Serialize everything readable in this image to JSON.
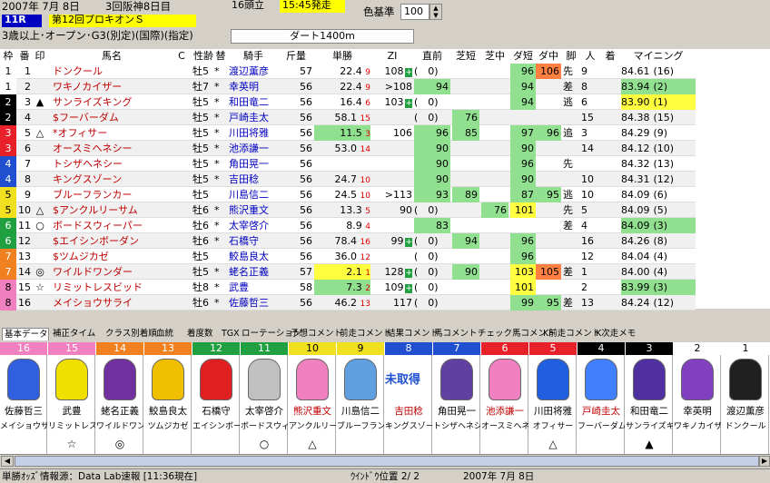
{
  "header": {
    "date": "2007年 7月 8日",
    "meeting": "3回阪神8日目",
    "field_size": "16頭立",
    "post_time": "15:45発走",
    "race_no": "11R",
    "race_name": "第12回プロキオンＳ",
    "conditions": "3歳以上･オープン･G3(別定)(国際)(指定)",
    "course": "ダート1400m",
    "color_label": "色基準",
    "color_value": "100"
  },
  "columns": [
    "枠",
    "番",
    "印",
    "馬名",
    "C",
    "性齢",
    "替",
    "騎手",
    "斤量",
    "単勝",
    "ZI",
    "直前",
    "芝短",
    "芝中",
    "ダ短",
    "ダ中",
    "脚",
    "人",
    "着",
    "マイニング"
  ],
  "rows": [
    {
      "waku": "1",
      "ban": "1",
      "mark": "",
      "name": "ドンクール",
      "sexage": "牡5",
      "ch": "*",
      "jockey": "渡辺薫彦",
      "kin": "57",
      "odds": "22.4",
      "pop": "9",
      "zi": "108",
      "zi_mark": "+",
      "choku": "(　0)",
      "shiba_s": "",
      "shiba_m": "",
      "da_s": "96",
      "da_m": "106",
      "kyaku": "先",
      "ninki": "9",
      "chaku": "",
      "mining": "84.61",
      "mrank": "(16)"
    },
    {
      "waku": "1",
      "ban": "2",
      "mark": "",
      "name": "ワキノカイザー",
      "sexage": "牡7",
      "ch": "*",
      "jockey": "幸英明",
      "kin": "56",
      "odds": "22.4",
      "pop": "9",
      "zi": ">108",
      "zi_mark": "",
      "choku": "94",
      "shiba_s": "",
      "shiba_m": "",
      "da_s": "94",
      "da_m": "",
      "kyaku": "差",
      "ninki": "8",
      "chaku": "",
      "mining": "83.94",
      "mrank": "(2)"
    },
    {
      "waku": "2",
      "ban": "3",
      "mark": "▲",
      "name": "サンライズキング",
      "sexage": "牡5",
      "ch": "*",
      "jockey": "和田竜二",
      "kin": "56",
      "odds": "16.4",
      "pop": "6",
      "zi": "103",
      "zi_mark": "+",
      "choku": "(　0)",
      "shiba_s": "",
      "shiba_m": "",
      "da_s": "94",
      "da_m": "",
      "kyaku": "逃",
      "ninki": "6",
      "chaku": "",
      "mining": "83.90",
      "mrank": "(1)"
    },
    {
      "waku": "2",
      "ban": "4",
      "mark": "",
      "name": "$フーバーダム",
      "sexage": "牡5",
      "ch": "*",
      "jockey": "戸崎圭太",
      "kin": "56",
      "odds": "58.1",
      "pop": "15",
      "zi": "",
      "zi_mark": "",
      "choku": "(　0)",
      "shiba_s": "76",
      "shiba_m": "",
      "da_s": "",
      "da_m": "",
      "kyaku": "",
      "ninki": "15",
      "chaku": "",
      "mining": "84.38",
      "mrank": "(15)"
    },
    {
      "waku": "3",
      "ban": "5",
      "mark": "△",
      "name": "*オフィサー",
      "sexage": "牡5",
      "ch": "*",
      "jockey": "川田将雅",
      "kin": "56",
      "odds": "11.5",
      "pop": "3",
      "zi": "106",
      "zi_mark": "",
      "choku": "96",
      "shiba_s": "85",
      "shiba_m": "",
      "da_s": "97",
      "da_m": "96",
      "kyaku": "追",
      "ninki": "3",
      "chaku": "",
      "mining": "84.29",
      "mrank": "(9)"
    },
    {
      "waku": "3",
      "ban": "6",
      "mark": "",
      "name": "オースミヘネシー",
      "sexage": "牡5",
      "ch": "*",
      "jockey": "池添謙一",
      "kin": "56",
      "odds": "53.0",
      "pop": "14",
      "zi": "",
      "zi_mark": "",
      "choku": "90",
      "shiba_s": "",
      "shiba_m": "",
      "da_s": "90",
      "da_m": "",
      "kyaku": "",
      "ninki": "14",
      "chaku": "",
      "mining": "84.12",
      "mrank": "(10)"
    },
    {
      "waku": "4",
      "ban": "7",
      "mark": "",
      "name": "トシザヘネシー",
      "sexage": "牡5",
      "ch": "*",
      "jockey": "角田晃一",
      "kin": "56",
      "odds": "",
      "pop": "",
      "zi": "",
      "zi_mark": "",
      "choku": "90",
      "shiba_s": "",
      "shiba_m": "",
      "da_s": "96",
      "da_m": "",
      "kyaku": "先",
      "ninki": "",
      "chaku": "",
      "mining": "84.32",
      "mrank": "(13)"
    },
    {
      "waku": "4",
      "ban": "8",
      "mark": "",
      "name": "キングスゾーン",
      "sexage": "牡5",
      "ch": "*",
      "jockey": "吉田稔",
      "kin": "56",
      "odds": "24.7",
      "pop": "10",
      "zi": "",
      "zi_mark": "",
      "choku": "90",
      "shiba_s": "",
      "shiba_m": "",
      "da_s": "90",
      "da_m": "",
      "kyaku": "",
      "ninki": "10",
      "chaku": "",
      "mining": "84.31",
      "mrank": "(12)"
    },
    {
      "waku": "5",
      "ban": "9",
      "mark": "",
      "name": "ブルーフランカー",
      "sexage": "牡5",
      "ch": "",
      "jockey": "川島信二",
      "kin": "56",
      "odds": "24.5",
      "pop": "10",
      "zi": ">113",
      "zi_mark": "",
      "choku": "93",
      "shiba_s": "89",
      "shiba_m": "",
      "da_s": "87",
      "da_m": "95",
      "kyaku": "逃",
      "ninki": "10",
      "chaku": "",
      "mining": "84.09",
      "mrank": "(6)"
    },
    {
      "waku": "5",
      "ban": "10",
      "mark": "△",
      "name": "$アンクルリーサム",
      "sexage": "牡6",
      "ch": "*",
      "jockey": "熊沢重文",
      "kin": "56",
      "odds": "13.3",
      "pop": "5",
      "zi": "90",
      "zi_mark": "",
      "choku": "(　0)",
      "shiba_s": "",
      "shiba_m": "76",
      "da_s": "101",
      "da_m": "",
      "kyaku": "先",
      "ninki": "5",
      "chaku": "",
      "mining": "84.09",
      "mrank": "(5)"
    },
    {
      "waku": "6",
      "ban": "11",
      "mark": "○",
      "name": "ボードスウィーパー",
      "sexage": "牡6",
      "ch": "*",
      "jockey": "太宰啓介",
      "kin": "56",
      "odds": "8.9",
      "pop": "4",
      "zi": "",
      "zi_mark": "",
      "choku": "83",
      "shiba_s": "",
      "shiba_m": "",
      "da_s": "",
      "da_m": "",
      "kyaku": "差",
      "ninki": "4",
      "chaku": "",
      "mining": "84.09",
      "mrank": "(3)"
    },
    {
      "waku": "6",
      "ban": "12",
      "mark": "",
      "name": "$エイシンボーダン",
      "sexage": "牡6",
      "ch": "*",
      "jockey": "石橋守",
      "kin": "56",
      "odds": "78.4",
      "pop": "16",
      "zi": "99",
      "zi_mark": "+",
      "choku": "(　0)",
      "shiba_s": "94",
      "shiba_m": "",
      "da_s": "96",
      "da_m": "",
      "kyaku": "",
      "ninki": "16",
      "chaku": "",
      "mining": "84.26",
      "mrank": "(8)"
    },
    {
      "waku": "7",
      "ban": "13",
      "mark": "",
      "name": "$ツムジカゼ",
      "sexage": "牡5",
      "ch": "",
      "jockey": "鮫島良太",
      "kin": "56",
      "odds": "36.0",
      "pop": "12",
      "zi": "",
      "zi_mark": "",
      "choku": "(　0)",
      "shiba_s": "",
      "shiba_m": "",
      "da_s": "96",
      "da_m": "",
      "kyaku": "",
      "ninki": "12",
      "chaku": "",
      "mining": "84.04",
      "mrank": "(4)"
    },
    {
      "waku": "7",
      "ban": "14",
      "mark": "◎",
      "name": "ワイルドワンダー",
      "sexage": "牡5",
      "ch": "*",
      "jockey": "蛯名正義",
      "kin": "57",
      "odds": "2.1",
      "pop": "1",
      "zi": "128",
      "zi_mark": "+",
      "choku": "(　0)",
      "shiba_s": "90",
      "shiba_m": "",
      "da_s": "103",
      "da_m": "105",
      "kyaku": "差",
      "ninki": "1",
      "chaku": "",
      "mining": "84.00",
      "mrank": "(4)"
    },
    {
      "waku": "8",
      "ban": "15",
      "mark": "☆",
      "name": "リミットレスビッド",
      "sexage": "牡8",
      "ch": "*",
      "jockey": "武豊",
      "kin": "58",
      "odds": "7.3",
      "pop": "2",
      "zi": "109",
      "zi_mark": "+",
      "choku": "(　0)",
      "shiba_s": "",
      "shiba_m": "",
      "da_s": "101",
      "da_m": "",
      "kyaku": "",
      "ninki": "2",
      "chaku": "",
      "mining": "83.99",
      "mrank": "(3)"
    },
    {
      "waku": "8",
      "ban": "16",
      "mark": "",
      "name": "メイショウサライ",
      "sexage": "牡6",
      "ch": "*",
      "jockey": "佐藤哲三",
      "kin": "56",
      "odds": "46.2",
      "pop": "13",
      "zi": "117",
      "zi_mark": "",
      "choku": "(　0)",
      "shiba_s": "",
      "shiba_m": "",
      "da_s": "99",
      "da_m": "95",
      "kyaku": "差",
      "ninki": "13",
      "chaku": "",
      "mining": "84.24",
      "mrank": "(12)"
    }
  ],
  "tabs": [
    "基本データ",
    "補正タイム",
    "クラス別着順",
    "血統",
    "着度数",
    "TGX",
    "ローテーション",
    "予想コメント",
    "前走コメント",
    "結果コメント",
    "馬コメント",
    "チェック馬コメント",
    "K前走コメント",
    "K次走メモ"
  ],
  "silks": [
    {
      "num": "16",
      "jockey": "佐藤哲三",
      "horse": "メイショウサラ",
      "mark": ""
    },
    {
      "num": "15",
      "jockey": "武豊",
      "horse": "リミットレスビ",
      "mark": "☆"
    },
    {
      "num": "14",
      "jockey": "蛯名正義",
      "horse": "ワイルドワン",
      "mark": "◎"
    },
    {
      "num": "13",
      "jockey": "鮫島良太",
      "horse": "ツムジカゼ",
      "mark": ""
    },
    {
      "num": "12",
      "jockey": "石橋守",
      "horse": "エイシンボー",
      "mark": ""
    },
    {
      "num": "11",
      "jockey": "太宰啓介",
      "horse": "ボードスウィ",
      "mark": "○"
    },
    {
      "num": "10",
      "jockey": "熊沢重文",
      "horse": "アンクルリー",
      "mark": "△"
    },
    {
      "num": "9",
      "jockey": "川島信二",
      "horse": "ブルーフラン",
      "mark": ""
    },
    {
      "num": "8",
      "jockey": "吉田稔",
      "horse": "キングスゾー",
      "mark": "",
      "label": "未取得"
    },
    {
      "num": "7",
      "jockey": "角田晃一",
      "horse": "トシザヘネシ",
      "mark": ""
    },
    {
      "num": "6",
      "jockey": "池添謙一",
      "horse": "オースミヘネ",
      "mark": ""
    },
    {
      "num": "5",
      "jockey": "川田将雅",
      "horse": "オフィサー",
      "mark": "△"
    },
    {
      "num": "4",
      "jockey": "戸崎圭太",
      "horse": "フーバーダム",
      "mark": ""
    },
    {
      "num": "3",
      "jockey": "和田竜二",
      "horse": "サンライズキ",
      "mark": "▲"
    },
    {
      "num": "2",
      "jockey": "幸英明",
      "horse": "ワキノカイザ",
      "mark": ""
    },
    {
      "num": "1",
      "jockey": "渡辺薫彦",
      "horse": "ドンクール",
      "mark": ""
    }
  ],
  "status": {
    "source": "単勝ｵｯｽﾞ情報源：Data Lab速報 [11:36現在]",
    "window_pos": "ｳｲﾝﾄﾞｳ位置 2/ 2",
    "date": "2007年 7月 8日"
  },
  "colors": {
    "waku1": "#ffffff",
    "waku2": "#000000",
    "waku3": "#e8202a",
    "waku4": "#2050d0",
    "waku5": "#f0e020",
    "waku6": "#20a040",
    "waku7": "#f08020",
    "waku8": "#f080c0",
    "green": "#90e090",
    "orange": "#ff8040",
    "yellow": "#ffff40"
  }
}
